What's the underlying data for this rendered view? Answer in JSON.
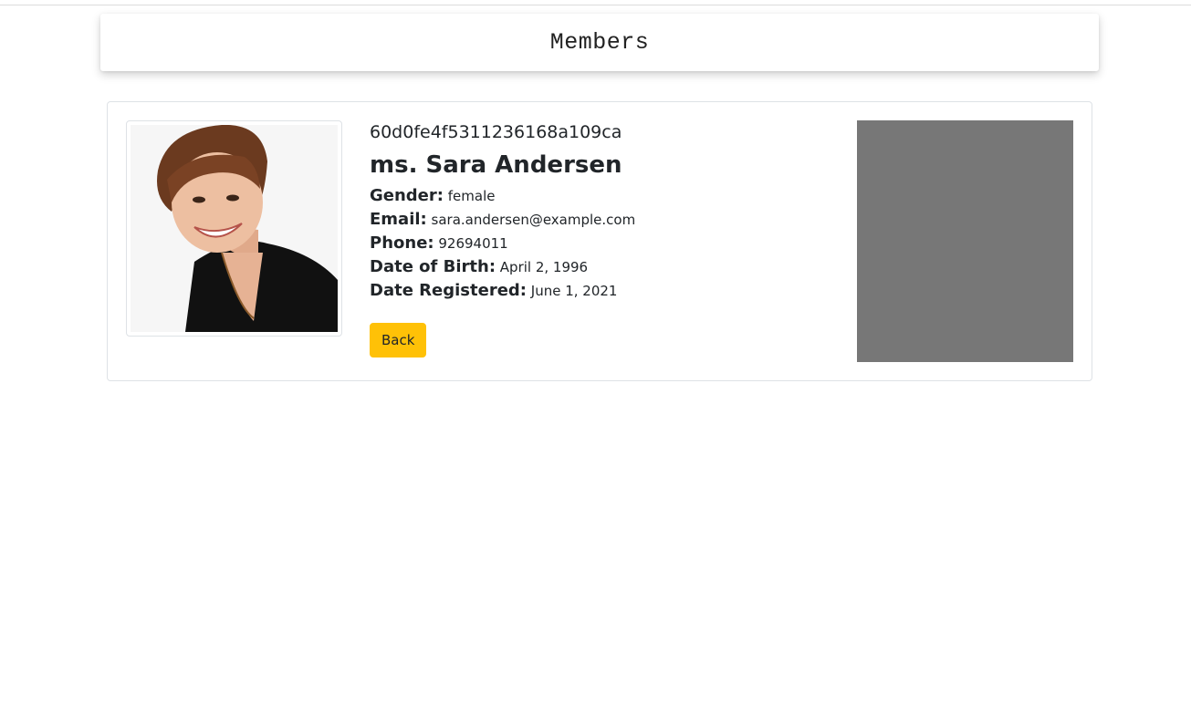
{
  "header": {
    "title": "Members"
  },
  "member": {
    "id": "60d0fe4f5311236168a109ca",
    "name": "ms. Sara Andersen",
    "fields": [
      {
        "label": "Gender:",
        "value": "female"
      },
      {
        "label": "Email:",
        "value": "sara.andersen@example.com"
      },
      {
        "label": "Phone:",
        "value": "92694011"
      },
      {
        "label": "Date of Birth:",
        "value": "April 2, 1996"
      },
      {
        "label": "Date Registered:",
        "value": "June 1, 2021"
      }
    ]
  },
  "actions": {
    "back_label": "Back"
  },
  "colors": {
    "accent": "#ffc107",
    "map_placeholder": "#777777"
  }
}
